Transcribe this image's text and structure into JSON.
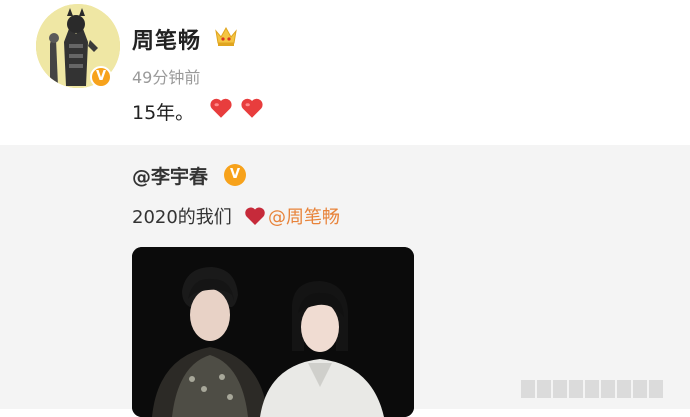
{
  "post": {
    "username": "周笔畅",
    "time": "49分钟前",
    "text": "15年。",
    "heart_count": 2
  },
  "repost": {
    "username": "@李宇春",
    "text": "2020的我们",
    "mention": "@周笔畅"
  },
  "colors": {
    "badge": "#f7a21b",
    "mention": "#e8833a",
    "heart": "#e83d3d",
    "repost_bg": "#f4f4f4"
  },
  "icons": [
    "crown-icon",
    "heart-icon",
    "verified-badge-icon"
  ]
}
